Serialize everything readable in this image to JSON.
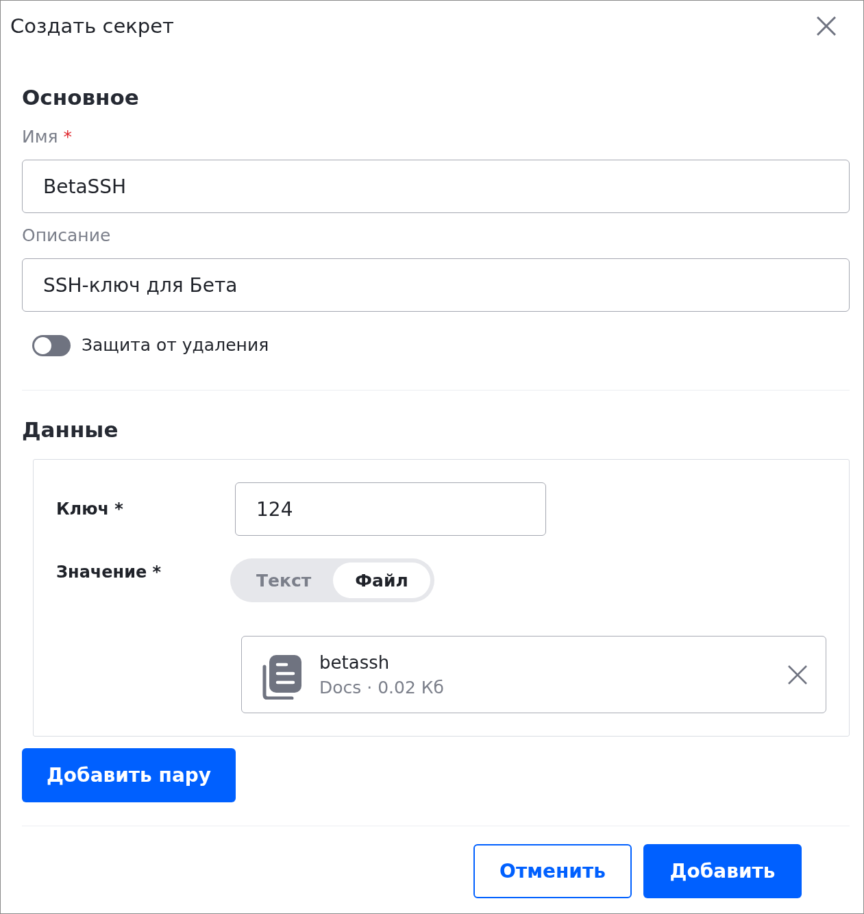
{
  "dialog": {
    "title": "Создать секрет"
  },
  "basic": {
    "heading": "Основное",
    "fields": [
      {
        "label": "Имя",
        "required_mark": "*",
        "value": "BetaSSH"
      },
      {
        "label": "Описание",
        "value": "SSH-ключ для Бета"
      }
    ],
    "toggle": {
      "label": "Защита от удаления",
      "on": false
    }
  },
  "data": {
    "heading": "Данные",
    "pairs": [
      {
        "key_label": "Ключ *",
        "key_value": "124",
        "value_label": "Значение *",
        "modes": [
          {
            "label": "Текст",
            "selected": false
          },
          {
            "label": "Файл",
            "selected": true
          }
        ],
        "file": {
          "name": "betassh",
          "meta": "Docs · 0.02 Кб"
        }
      }
    ],
    "add_pair_button": "Добавить пару"
  },
  "footer": {
    "buttons": [
      {
        "label": "Отменить",
        "kind": "secondary"
      },
      {
        "label": "Добавить",
        "kind": "primary"
      }
    ]
  }
}
